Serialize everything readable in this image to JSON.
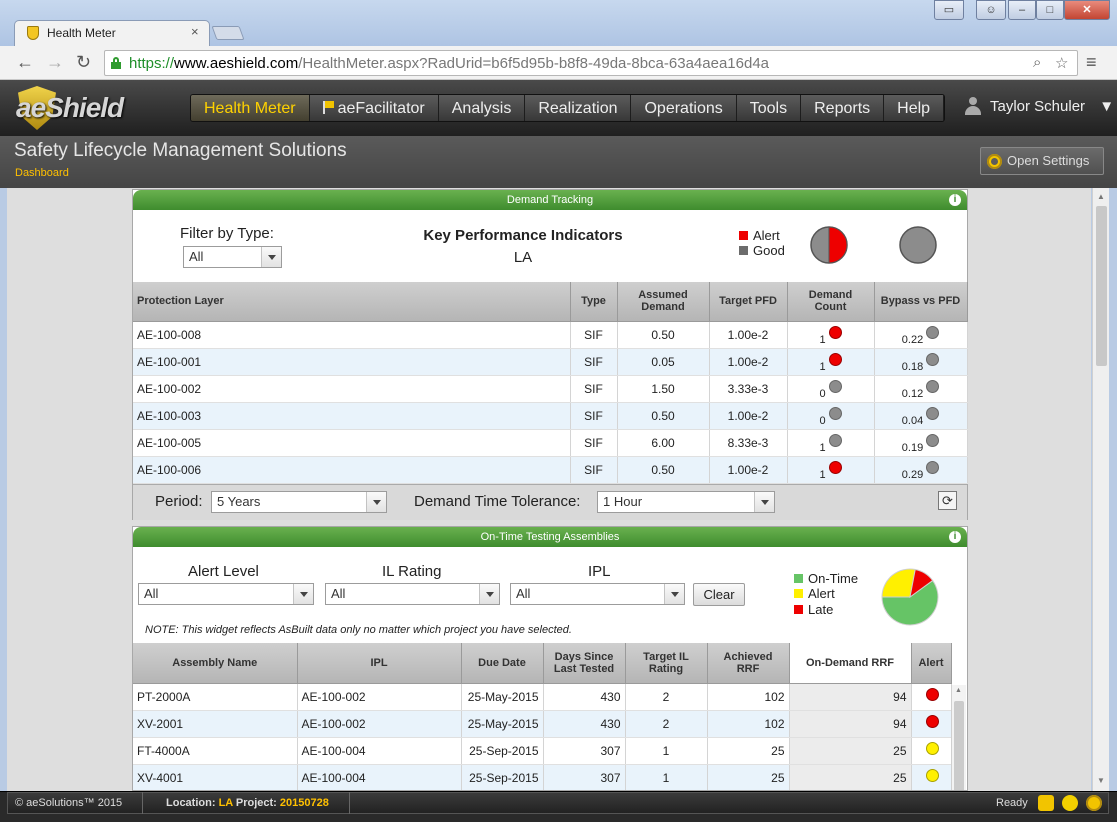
{
  "browser": {
    "tab_title": "Health Meter",
    "tab_close": "×",
    "url_scheme": "https://",
    "url_host": "www.aeshield.com",
    "url_path": "/HealthMeter.aspx?RadUrid=b6f5d95b-b8f8-49da-8bca-63a4aea16d4a"
  },
  "app": {
    "logo": "aeShield",
    "menu": [
      {
        "label": "Health Meter",
        "active": true
      },
      {
        "label": "aeFacilitator"
      },
      {
        "label": "Analysis"
      },
      {
        "label": "Realization"
      },
      {
        "label": "Operations"
      },
      {
        "label": "Tools"
      },
      {
        "label": "Reports"
      },
      {
        "label": "Help"
      }
    ],
    "user": "Taylor Schuler",
    "page_title": "Safety Lifecycle Management Solutions",
    "breadcrumb": "Dashboard",
    "settings_button": "Open Settings"
  },
  "demand": {
    "header": "Demand Tracking",
    "filter_label": "Filter by Type:",
    "filter_value": "All",
    "kpi_title": "Key Performance Indicators",
    "kpi_location": "LA",
    "legend_alert": "Alert",
    "legend_good": "Good",
    "columns": [
      "Protection Layer",
      "Type",
      "Assumed Demand",
      "Target PFD",
      "Demand Count",
      "Bypass vs PFD"
    ],
    "rows": [
      {
        "layer": "AE-100-008",
        "type": "SIF",
        "demand": "0.50",
        "pfd": "1.00e-2",
        "count": "1",
        "count_status": "red",
        "bypass": "0.22",
        "bypass_status": "gray"
      },
      {
        "layer": "AE-100-001",
        "type": "SIF",
        "demand": "0.05",
        "pfd": "1.00e-2",
        "count": "1",
        "count_status": "red",
        "bypass": "0.18",
        "bypass_status": "gray"
      },
      {
        "layer": "AE-100-002",
        "type": "SIF",
        "demand": "1.50",
        "pfd": "3.33e-3",
        "count": "0",
        "count_status": "gray",
        "bypass": "0.12",
        "bypass_status": "gray"
      },
      {
        "layer": "AE-100-003",
        "type": "SIF",
        "demand": "0.50",
        "pfd": "1.00e-2",
        "count": "0",
        "count_status": "gray",
        "bypass": "0.04",
        "bypass_status": "gray"
      },
      {
        "layer": "AE-100-005",
        "type": "SIF",
        "demand": "6.00",
        "pfd": "8.33e-3",
        "count": "1",
        "count_status": "gray",
        "bypass": "0.19",
        "bypass_status": "gray"
      },
      {
        "layer": "AE-100-006",
        "type": "SIF",
        "demand": "0.50",
        "pfd": "1.00e-2",
        "count": "1",
        "count_status": "red",
        "bypass": "0.29",
        "bypass_status": "gray"
      }
    ],
    "period_label": "Period:",
    "period_value": "5 Years",
    "tolerance_label": "Demand Time Tolerance:",
    "tolerance_value": "1 Hour"
  },
  "ontime": {
    "header": "On-Time Testing Assemblies",
    "alert_level_label": "Alert Level",
    "alert_level_value": "All",
    "il_rating_label": "IL Rating",
    "il_rating_value": "All",
    "ipl_label": "IPL",
    "ipl_value": "All",
    "clear_button": "Clear",
    "legend_ontime": "On-Time",
    "legend_alert": "Alert",
    "legend_late": "Late",
    "note": "NOTE: This widget reflects AsBuilt data only no matter which project you have selected.",
    "columns": [
      "Assembly Name",
      "IPL",
      "Due Date",
      "Days Since Last Tested",
      "Target IL Rating",
      "Achieved RRF",
      "On-Demand RRF",
      "Alert"
    ],
    "rows": [
      {
        "name": "PT-2000A",
        "ipl": "AE-100-002",
        "due": "25-May-2015",
        "days": "430",
        "target": "2",
        "achieved": "102",
        "ondemand": "94",
        "alert": "red"
      },
      {
        "name": "XV-2001",
        "ipl": "AE-100-002",
        "due": "25-May-2015",
        "days": "430",
        "target": "2",
        "achieved": "102",
        "ondemand": "94",
        "alert": "red"
      },
      {
        "name": "FT-4000A",
        "ipl": "AE-100-004",
        "due": "25-Sep-2015",
        "days": "307",
        "target": "1",
        "achieved": "25",
        "ondemand": "25",
        "alert": "yellow"
      },
      {
        "name": "XV-4001",
        "ipl": "AE-100-004",
        "due": "25-Sep-2015",
        "days": "307",
        "target": "1",
        "achieved": "25",
        "ondemand": "25",
        "alert": "yellow"
      }
    ]
  },
  "status": {
    "copyright": "© aeSolutions™ 2015",
    "location_label": "Location:",
    "location_value": "LA",
    "project_label": "Project:",
    "project_value": "20150728",
    "ready": "Ready"
  },
  "colors": {
    "alert": "#ee0000",
    "good": "#8c8c8c",
    "ontime": "#66c466",
    "late_alert": "#fff000"
  }
}
